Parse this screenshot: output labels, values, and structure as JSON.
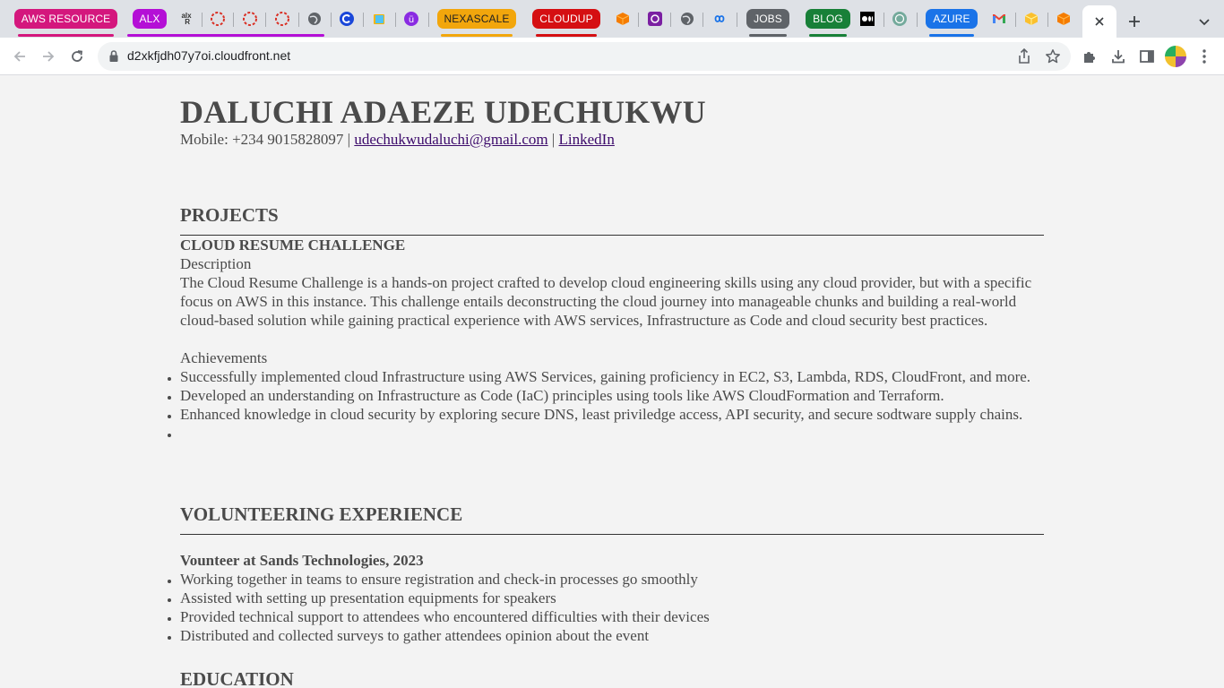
{
  "browser": {
    "tabs": [
      {
        "kind": "pill",
        "label": "AWS RESOURCE",
        "bg": "#d4177d",
        "underline": "#d4177d"
      },
      {
        "kind": "pill",
        "label": "ALX",
        "bg": "#b40fd6",
        "underline": "#b40fd6"
      },
      {
        "kind": "icon",
        "icon": "alx-icon"
      },
      {
        "kind": "icon",
        "icon": "loading-circle-icon"
      },
      {
        "kind": "icon",
        "icon": "loading-circle-icon"
      },
      {
        "kind": "icon",
        "icon": "loading-circle-icon"
      },
      {
        "kind": "icon",
        "icon": "globe-icon"
      },
      {
        "kind": "icon",
        "icon": "c-logo-icon"
      },
      {
        "kind": "icon",
        "icon": "book-icon"
      },
      {
        "kind": "icon",
        "icon": "purple-u-icon"
      },
      {
        "kind": "pill",
        "label": "NEXASCALE",
        "bg": "#f2a60c",
        "underline": "#f2a60c",
        "text_color": "#222222"
      },
      {
        "kind": "pill",
        "label": "CLOUDUP",
        "bg": "#d50f12",
        "underline": "#d50f12"
      },
      {
        "kind": "icon",
        "icon": "orange-cube-icon"
      },
      {
        "kind": "icon",
        "icon": "purple-hex-icon"
      },
      {
        "kind": "icon",
        "icon": "globe-icon"
      },
      {
        "kind": "icon",
        "icon": "infinity-icon"
      },
      {
        "kind": "pill",
        "label": "JOBS",
        "bg": "#5f6368",
        "underline": "#5f6368"
      },
      {
        "kind": "pill",
        "label": "BLOG",
        "bg": "#188038",
        "underline": "#188038"
      },
      {
        "kind": "icon",
        "icon": "medium-icon"
      },
      {
        "kind": "icon",
        "icon": "chatgpt-icon"
      },
      {
        "kind": "pill",
        "label": "AZURE",
        "bg": "#1a73e8",
        "underline": "#1a73e8"
      },
      {
        "kind": "icon",
        "icon": "gmail-icon"
      },
      {
        "kind": "icon",
        "icon": "yellow-cube-icon"
      },
      {
        "kind": "icon",
        "icon": "orange-cube-icon"
      }
    ],
    "active_tab_close": "close-icon",
    "new_tab": "plus-icon",
    "url": "d2xkfjdh07y7oi.cloudfront.net"
  },
  "resume": {
    "name": "DALUCHI ADAEZE UDECHUKWU",
    "contact": {
      "mobile": "Mobile: +234 9015828097",
      "sep1": " | ",
      "email": "udechukwudaluchi@gmail.com",
      "sep2": " | ",
      "linkedin": "LinkedIn"
    },
    "projects": {
      "heading": "PROJECTS",
      "title": "CLOUD RESUME CHALLENGE",
      "description_label": "Description",
      "description": "The Cloud Resume Challenge is a hands-on project crafted to develop cloud engineering skills using any cloud provider, but with a specific focus on AWS in this instance. This challenge entails deconstructing the cloud journey into manageable chunks and building a real-world cloud-based solution while gaining practical experience with AWS services, Infrastructure as Code and cloud security best practices.",
      "achievements_label": "Achievements",
      "achievements": [
        "Successfully implemented cloud Infrastructure using AWS Services, gaining proficiency in EC2, S3, Lambda, RDS, CloudFront, and more.",
        "Developed an understanding on Infrastructure as Code (IaC) principles using tools like AWS CloudFormation and Terraform.",
        "Enhanced knowledge in cloud security by exploring secure DNS, least priviledge access, API security, and secure sodtware supply chains.",
        ""
      ]
    },
    "volunteering": {
      "heading": "VOLUNTEERING EXPERIENCE",
      "role": "Vounteer at Sands Technologies, 2023",
      "items": [
        "Working together in teams to ensure registration and check-in processes go smoothly",
        "Assisted with setting up presentation equipments for speakers",
        "Provided technical support to attendees who encountered difficulties with their devices",
        "Distributed and collected surveys to gather attendees opinion about the event"
      ]
    },
    "education": {
      "heading": "EDUCATION"
    }
  }
}
